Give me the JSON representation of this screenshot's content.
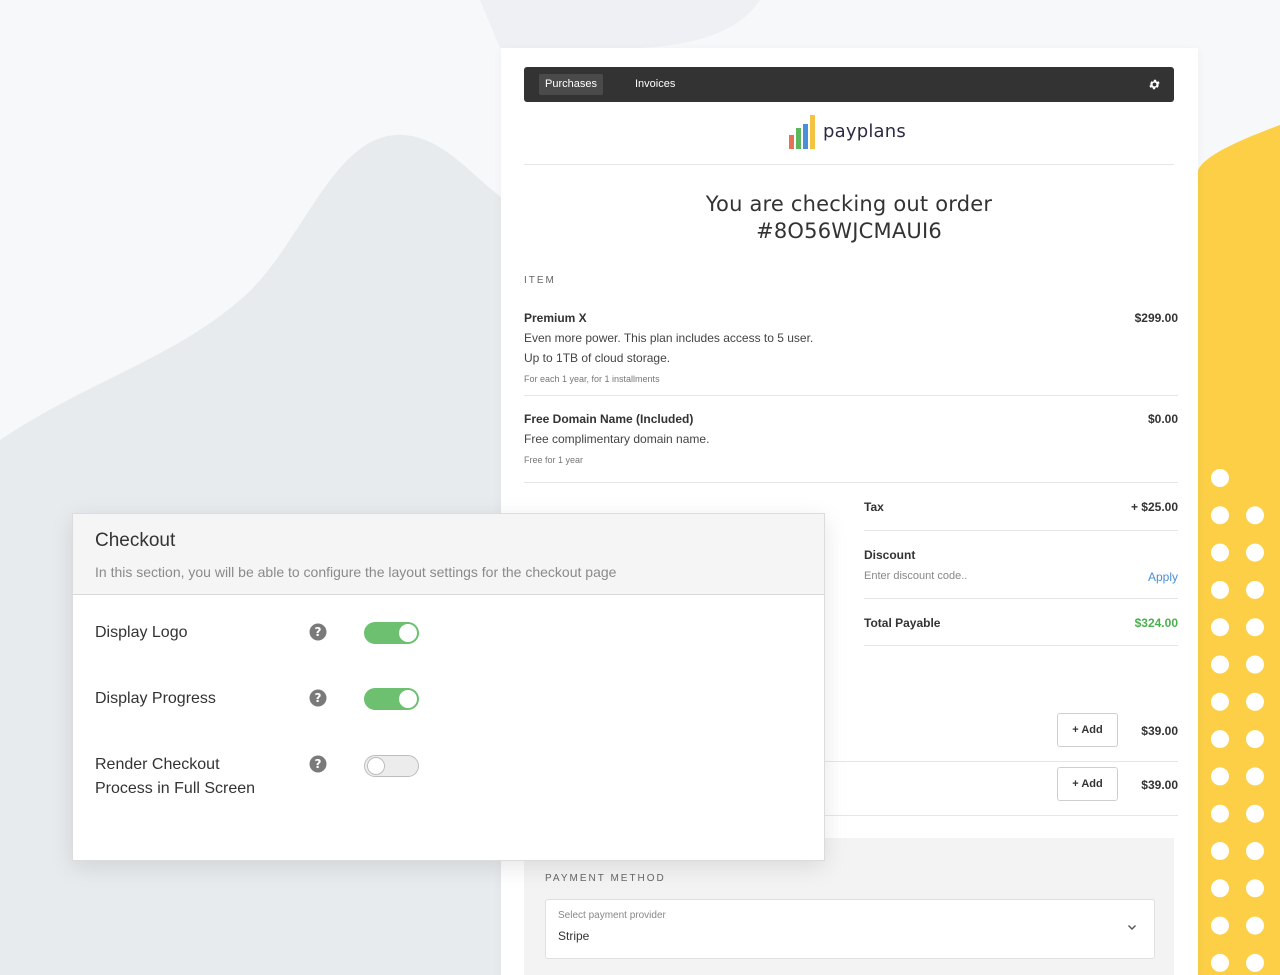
{
  "checkout_page": {
    "nav": {
      "tabs": [
        {
          "label": "Purchases",
          "active": true
        },
        {
          "label": "Invoices",
          "active": false
        }
      ],
      "settings_icon": "gear-icon"
    },
    "logo": {
      "text": "payplans",
      "bar_colors": [
        "#e57353",
        "#5cb85c",
        "#4a90d9",
        "#f5c342"
      ]
    },
    "order": {
      "line1": "You are checking out order",
      "line2": "#8O56WJCMAUI6"
    },
    "item_header": "ITEM",
    "items": [
      {
        "name": "Premium X",
        "price": "$299.00",
        "description": [
          "Even more power. This plan includes access to 5 user.",
          "Up to 1TB of cloud storage."
        ],
        "note": "For each 1 year, for 1 installments"
      },
      {
        "name": "Free Domain Name (Included)",
        "price": "$0.00",
        "description": [
          "Free complimentary domain name."
        ],
        "note": "Free for 1 year"
      }
    ],
    "summary": {
      "tax_label": "Tax",
      "tax_value": "+ $25.00",
      "discount_label": "Discount",
      "discount_placeholder": "Enter discount code..",
      "apply_label": "Apply",
      "total_label": "Total Payable",
      "total_value": "$324.00"
    },
    "addons": [
      {
        "button_label": "+ Add",
        "price": "$39.00"
      },
      {
        "button_label": "+ Add",
        "price": "$39.00"
      }
    ],
    "payment": {
      "header": "PAYMENT METHOD",
      "select_label": "Select payment provider",
      "select_value": "Stripe"
    }
  },
  "settings_panel": {
    "title": "Checkout",
    "subtitle": "In this section, you will be able to configure the layout settings for the checkout page",
    "options": [
      {
        "label": "Display Logo",
        "enabled": true
      },
      {
        "label": "Display Progress",
        "enabled": true
      },
      {
        "label": "Render Checkout Process in Full Screen",
        "enabled": false
      }
    ]
  },
  "colors": {
    "accent_green": "#6cc070",
    "total_green": "#4caf50",
    "link_blue": "#4a90d9",
    "brand_yellow": "#fccf46",
    "nav_dark": "#333333"
  }
}
